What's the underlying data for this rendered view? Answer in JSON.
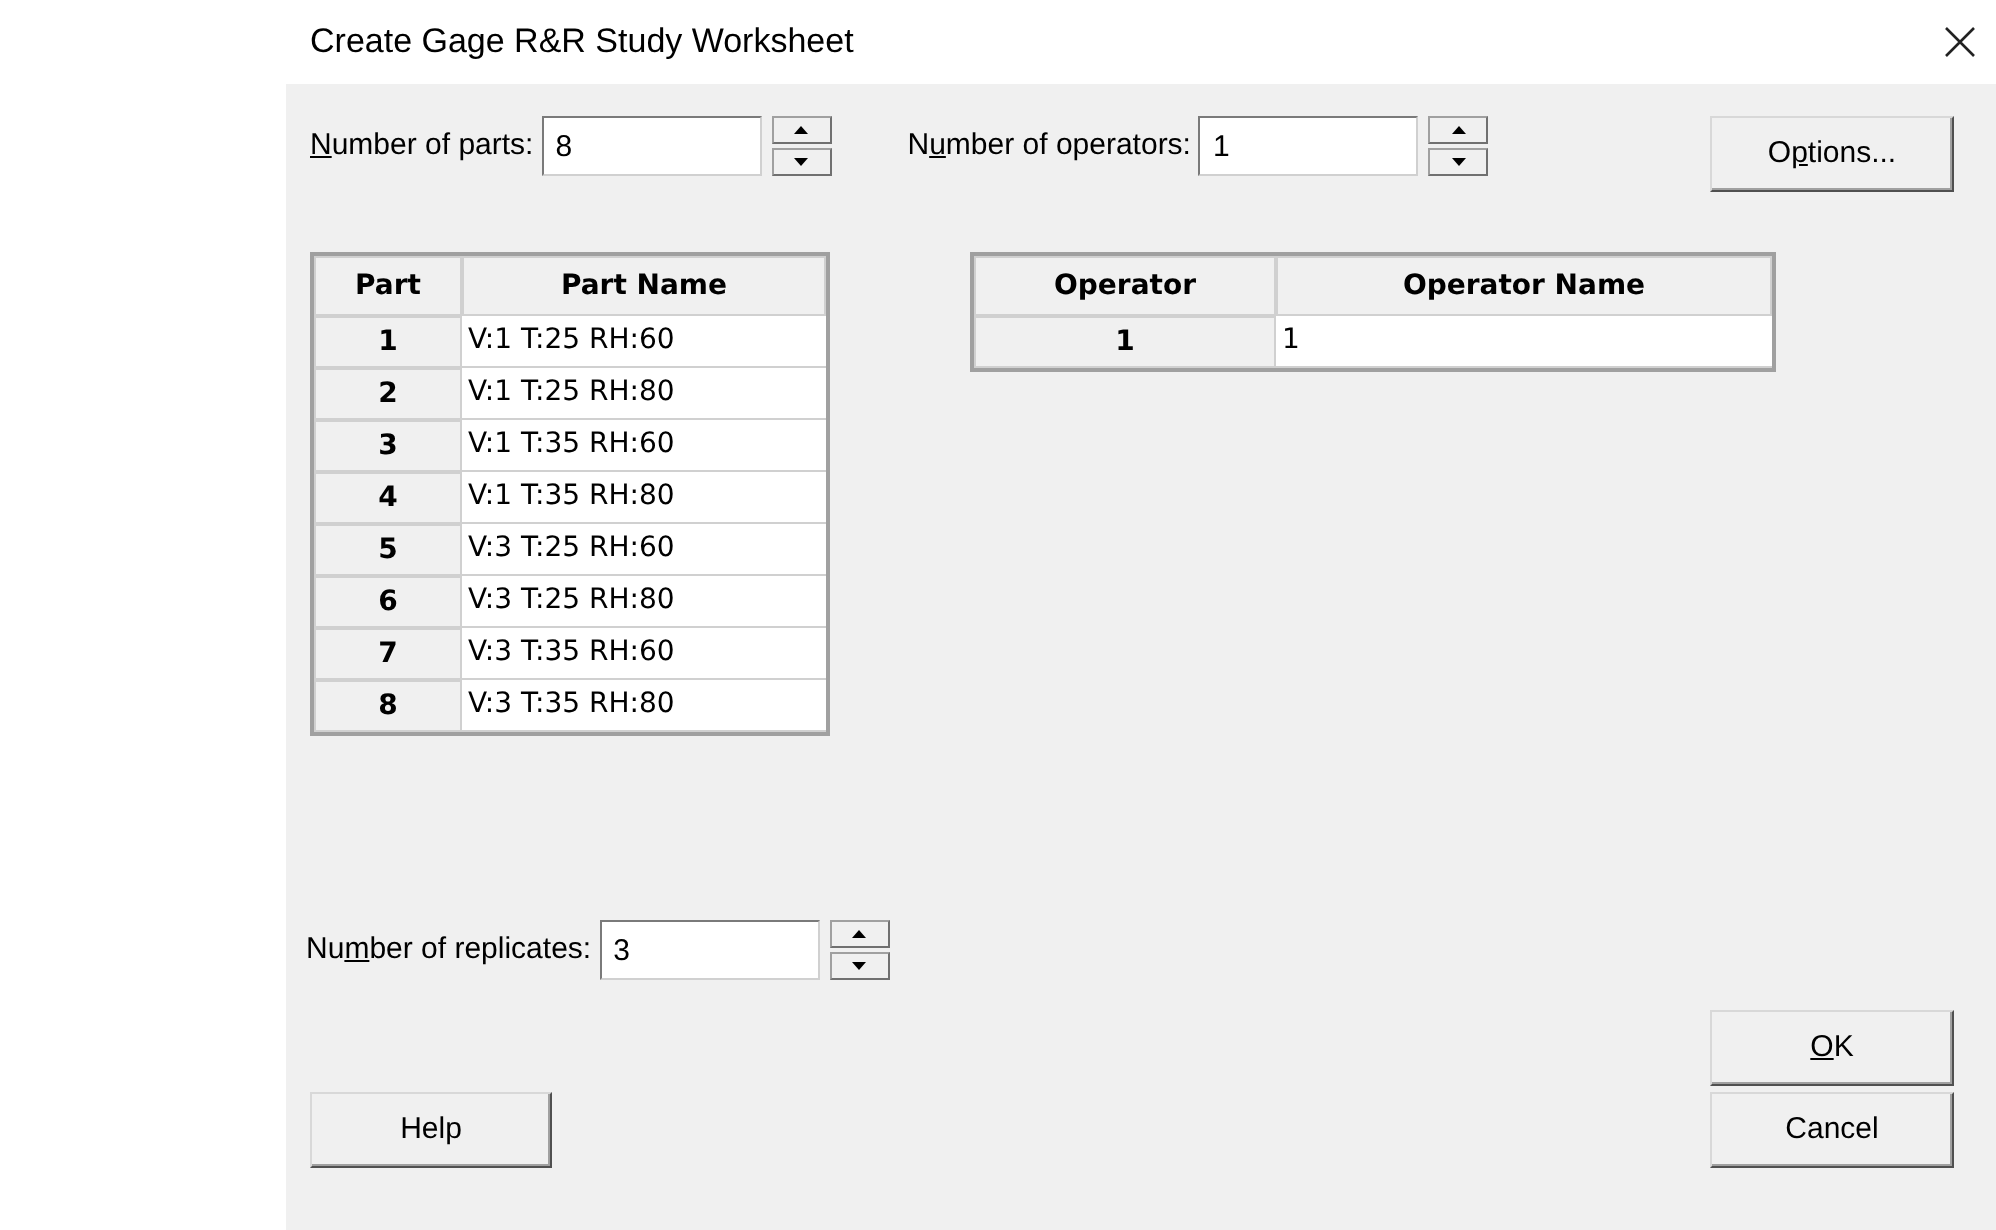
{
  "window": {
    "title": "Create Gage R&R Study Worksheet"
  },
  "parts_count": {
    "access_key": "N",
    "label_after": "umber of parts:",
    "value": "8"
  },
  "operators_count": {
    "label_before": "N",
    "access_key": "u",
    "label_after": "mber of operators:",
    "value": "1"
  },
  "options_button": {
    "label_before": "O",
    "access_key": "p",
    "label_after": "tions..."
  },
  "parts_table": {
    "columns": [
      "Part",
      "Part Name"
    ],
    "rows": [
      {
        "index": "1",
        "name": "V:1 T:25 RH:60"
      },
      {
        "index": "2",
        "name": "V:1 T:25 RH:80"
      },
      {
        "index": "3",
        "name": "V:1 T:35 RH:60"
      },
      {
        "index": "4",
        "name": "V:1 T:35 RH:80"
      },
      {
        "index": "5",
        "name": "V:3 T:25 RH:60"
      },
      {
        "index": "6",
        "name": "V:3 T:25 RH:80"
      },
      {
        "index": "7",
        "name": "V:3 T:35 RH:60"
      },
      {
        "index": "8",
        "name": "V:3 T:35 RH:80"
      }
    ]
  },
  "operators_table": {
    "columns": [
      "Operator",
      "Operator Name"
    ],
    "rows": [
      {
        "index": "1",
        "name": "1"
      }
    ]
  },
  "replicates_count": {
    "label_before": "Nu",
    "access_key": "m",
    "label_after": "ber of replicates:",
    "value": "3"
  },
  "buttons": {
    "ok": {
      "access_key": "O",
      "label_after": "K"
    },
    "cancel": {
      "label": "Cancel"
    },
    "help": {
      "label": "Help"
    }
  }
}
